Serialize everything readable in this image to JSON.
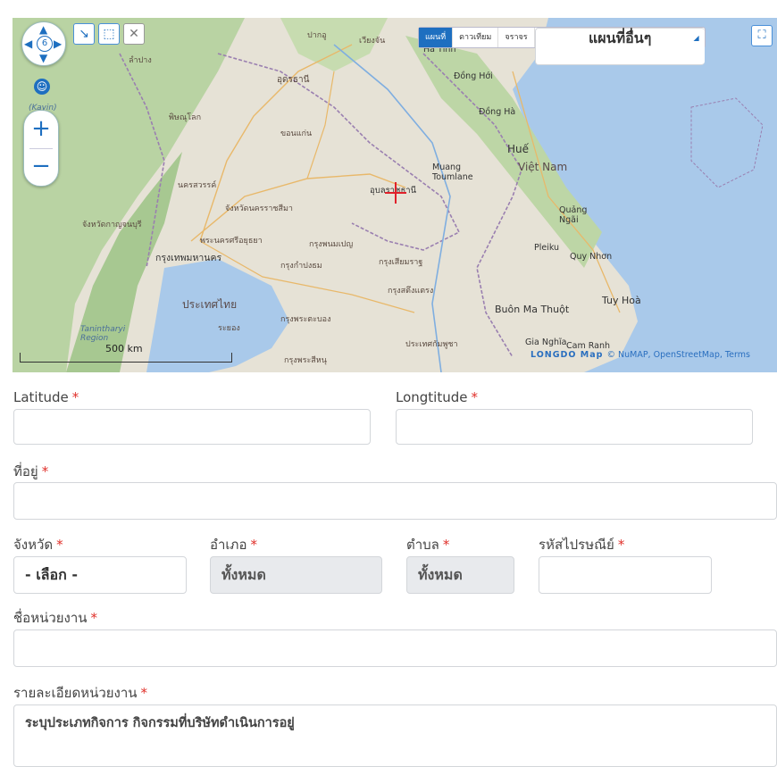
{
  "map": {
    "zoom_level": "6",
    "map_types": [
      "แผนที่",
      "ดาวเทียม",
      "จราจร"
    ],
    "map_type_active": "แผนที่",
    "other_maps_label": "แผนที่อื่นๆ",
    "scale_label": "500 km",
    "attribution_logo": "LONGDO Map",
    "attribution_text": "© NuMAP, OpenStreetMap, Terms",
    "place_labels": {
      "thaibinh": "ปากอู",
      "lampang": "ลำปาง",
      "phitsanulok": "พิษณุโลก",
      "nakhonsawan": "นครสวรรค์",
      "bangkok": "กรุงเทพมหานคร",
      "ayutthaya": "พระนครศรีอยุธยา",
      "udon": "อุดรธานี",
      "khonkaen": "ขอนแก่น",
      "korat": "จังหวัดนครราชสีมา",
      "ubon": "อุบลราชธานี",
      "vientiane": "เวียงจัน",
      "hatinh": "Hà Tĩnh",
      "donghoi": "Đồng Hới",
      "dongha": "Đồng Hà",
      "hue": "Huế",
      "vietnam": "Việt Nam",
      "muang": "Muang Toumlane",
      "quangngai": "Quảng Ngãi",
      "pleiku": "Pleiku",
      "quynhon": "Quy Nhơn",
      "tuyhoa": "Tuy Hoà",
      "buonmathuot": "Buôn Ma Thuột",
      "gianghia": "Gia Nghĩa",
      "camranh": "Cam Ranh",
      "thailand": "ประเทศไทย",
      "cambodia": "ประเทศกัมพูชา",
      "rayong": "ระยอง",
      "kayin": "(Kayin)",
      "tanintharyi": "Tanintharyi Region",
      "kanchanaburi": "จังหวัดกาญจนบุรี",
      "phnompenh": "กรุงพนมเปญ",
      "siemreap": "กรุงเสียมราฐ",
      "kampong": "กรุงกำปงธม",
      "battambang": "กรุงพระตะบอง",
      "stung": "กรุงสตึงแตรง",
      "sihanouk": "กรุงพระสีหนุ"
    }
  },
  "form": {
    "latitude": {
      "label": "Latitude",
      "value": ""
    },
    "longitude": {
      "label": "Longtitude",
      "value": ""
    },
    "address": {
      "label": "ที่อยู่",
      "value": ""
    },
    "province": {
      "label": "จังหวัด",
      "value": "- เลือก -"
    },
    "district": {
      "label": "อำเภอ",
      "value": "ทั้งหมด"
    },
    "subdistrict": {
      "label": "ตำบล",
      "value": "ทั้งหมด"
    },
    "postcode": {
      "label": "รหัสไปรษณีย์",
      "value": ""
    },
    "org_name": {
      "label": "ชื่อหน่วยงาน",
      "value": ""
    },
    "org_detail": {
      "label": "รายละเอียดหน่วยงาน",
      "value": "ระบุประเภทกิจการ กิจกรรมที่บริษัทดำเนินการอยู่"
    },
    "required_mark": "*"
  },
  "colors": {
    "accent": "#1e6fc0",
    "required": "#e0302a",
    "disabled_bg": "#e8eaed"
  }
}
